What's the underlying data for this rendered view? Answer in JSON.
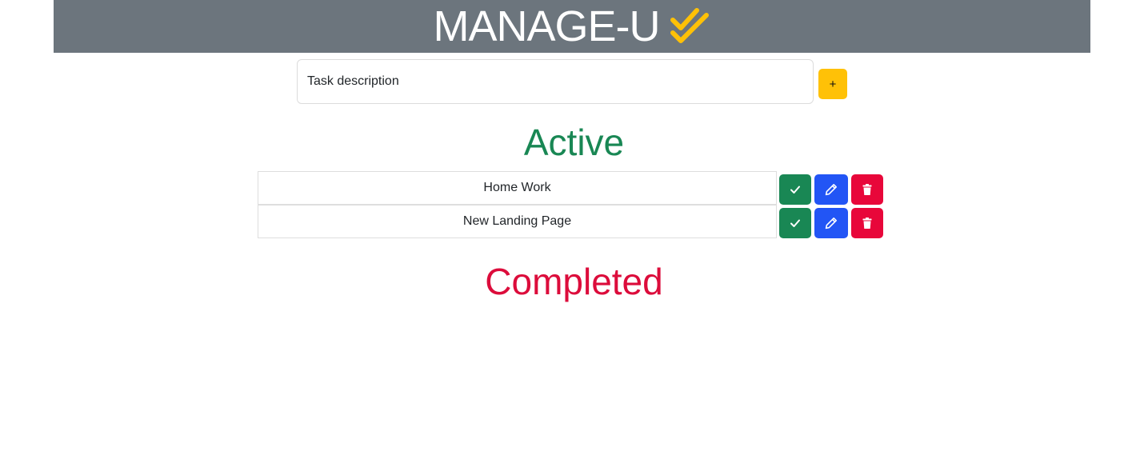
{
  "header": {
    "title": "MANAGE-U",
    "logo_icon": "double-check-icon",
    "background": "#6c757d",
    "logo_color": "#ffc107"
  },
  "task_input": {
    "placeholder": "Task description",
    "value": ""
  },
  "add_button": {
    "label": "+",
    "color": "#ffc107"
  },
  "sections": {
    "active": {
      "title": "Active",
      "color": "#198754"
    },
    "completed": {
      "title": "Completed",
      "color": "#dc0c3b"
    }
  },
  "active_tasks": [
    {
      "text": "Home Work"
    },
    {
      "text": "New Landing Page"
    }
  ],
  "completed_tasks": [],
  "task_actions": {
    "complete": {
      "icon": "check-icon",
      "color": "#198754"
    },
    "edit": {
      "icon": "pencil-icon",
      "color": "#2255f5"
    },
    "delete": {
      "icon": "trash-icon",
      "color": "#e8073a"
    }
  }
}
